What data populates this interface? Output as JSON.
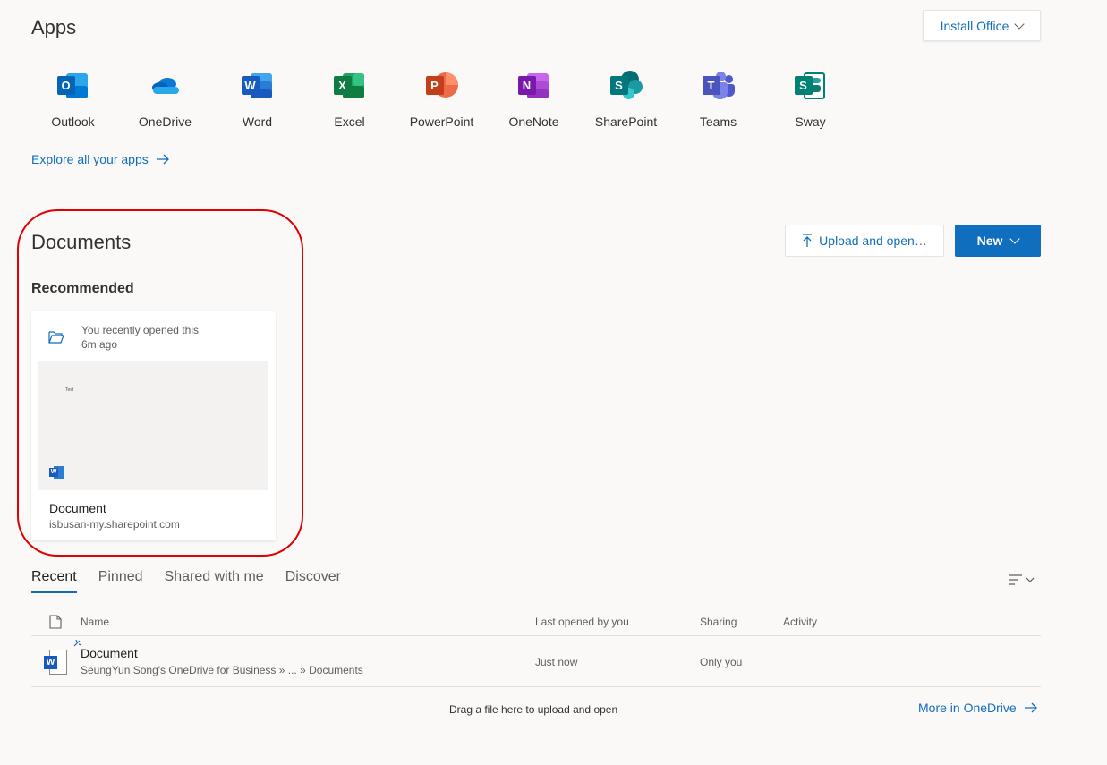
{
  "apps_section": {
    "title": "Apps",
    "install_label": "Install Office",
    "explore_label": "Explore all your apps",
    "apps": [
      {
        "label": "Outlook",
        "icon": "outlook-icon",
        "color": "#0078d4"
      },
      {
        "label": "OneDrive",
        "icon": "onedrive-icon",
        "color": "#0364b8"
      },
      {
        "label": "Word",
        "icon": "word-icon",
        "color": "#185abd"
      },
      {
        "label": "Excel",
        "icon": "excel-icon",
        "color": "#107c41"
      },
      {
        "label": "PowerPoint",
        "icon": "powerpoint-icon",
        "color": "#c43e1c"
      },
      {
        "label": "OneNote",
        "icon": "onenote-icon",
        "color": "#7719aa"
      },
      {
        "label": "SharePoint",
        "icon": "sharepoint-icon",
        "color": "#036c70"
      },
      {
        "label": "Teams",
        "icon": "teams-icon",
        "color": "#5059c9"
      },
      {
        "label": "Sway",
        "icon": "sway-icon",
        "color": "#008272"
      }
    ]
  },
  "documents_section": {
    "title": "Documents",
    "upload_label": "Upload and open…",
    "new_label": "New",
    "recommended_title": "Recommended",
    "card": {
      "activity_line1": "You recently opened this",
      "activity_line2": "6m ago",
      "thumbnail_text": "Test",
      "name": "Document",
      "site": "isbusan-my.sharepoint.com"
    }
  },
  "file_tabs": [
    "Recent",
    "Pinned",
    "Shared with me",
    "Discover"
  ],
  "table": {
    "columns": {
      "name": "Name",
      "last_opened": "Last opened by you",
      "sharing": "Sharing",
      "activity": "Activity"
    },
    "rows": [
      {
        "name": "Document",
        "path": "SeungYun Song's OneDrive for Business » ... » Documents",
        "last_opened": "Just now",
        "sharing": "Only you",
        "activity": ""
      }
    ]
  },
  "footer": {
    "drag_hint": "Drag a file here to upload and open",
    "more_label": "More in OneDrive"
  },
  "colors": {
    "accent": "#106ebe",
    "highlight": "#e00000"
  }
}
